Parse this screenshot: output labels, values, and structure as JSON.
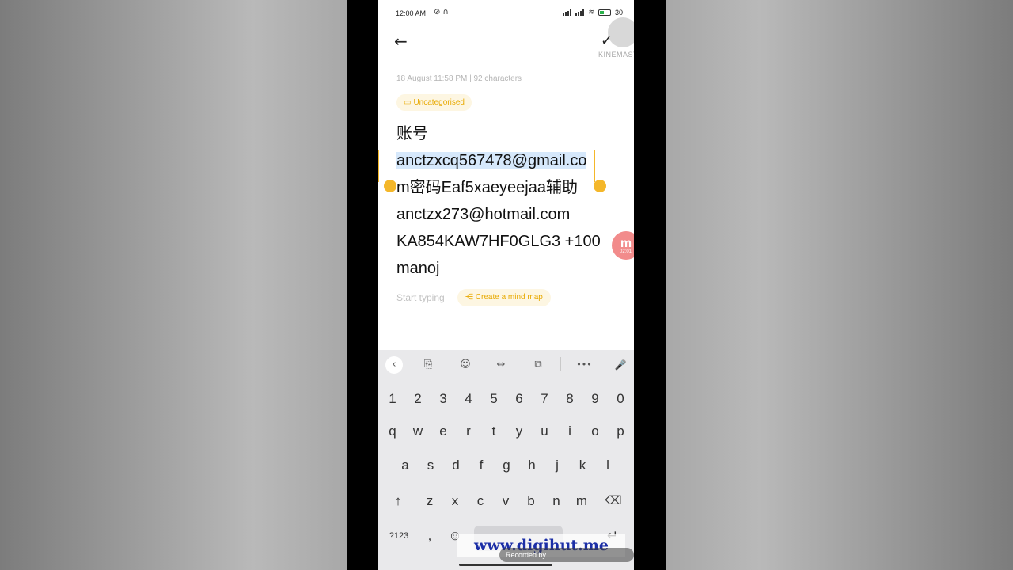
{
  "status_bar": {
    "time": "12:00 AM",
    "battery": "30"
  },
  "watermark": {
    "app": "KINEMASTER",
    "site": "www.digihut.me",
    "recorder": "Recorded by"
  },
  "note": {
    "meta": "18 August  11:58 PM  |  92 characters",
    "category": "Uncategorised",
    "lines": [
      "账号",
      "anctzxcq567478@gmail.co",
      "m密码Eaf5xaeyeejaa辅助",
      "anctzx273@hotmail.com",
      "KA854KAW7HF0GLG3 +100",
      "manoj"
    ],
    "placeholder": "Start typing",
    "mindmap_label": "Create a mind map"
  },
  "floating_badge": {
    "letter": "m",
    "time": "02:01"
  },
  "keyboard": {
    "number_row": [
      "1",
      "2",
      "3",
      "4",
      "5",
      "6",
      "7",
      "8",
      "9",
      "0"
    ],
    "row1": [
      "q",
      "w",
      "e",
      "r",
      "t",
      "y",
      "u",
      "i",
      "o",
      "p"
    ],
    "row2": [
      "a",
      "s",
      "d",
      "f",
      "g",
      "h",
      "j",
      "k",
      "l"
    ],
    "row3": [
      "z",
      "x",
      "c",
      "v",
      "b",
      "n",
      "m"
    ],
    "symbols_key": "?123",
    "comma_key": ","
  },
  "icons": {
    "back": "←",
    "check": "✓",
    "chevron": "‹",
    "translate": "⎘",
    "sticker": "☺",
    "cursor": "⇔",
    "clipboard": "⧉",
    "more": "•••",
    "mic": "🎤",
    "shift": "↑",
    "backspace": "⌫",
    "emoji": "☺",
    "enter": "↵",
    "folder": "▭",
    "mindmap": "⋲"
  }
}
